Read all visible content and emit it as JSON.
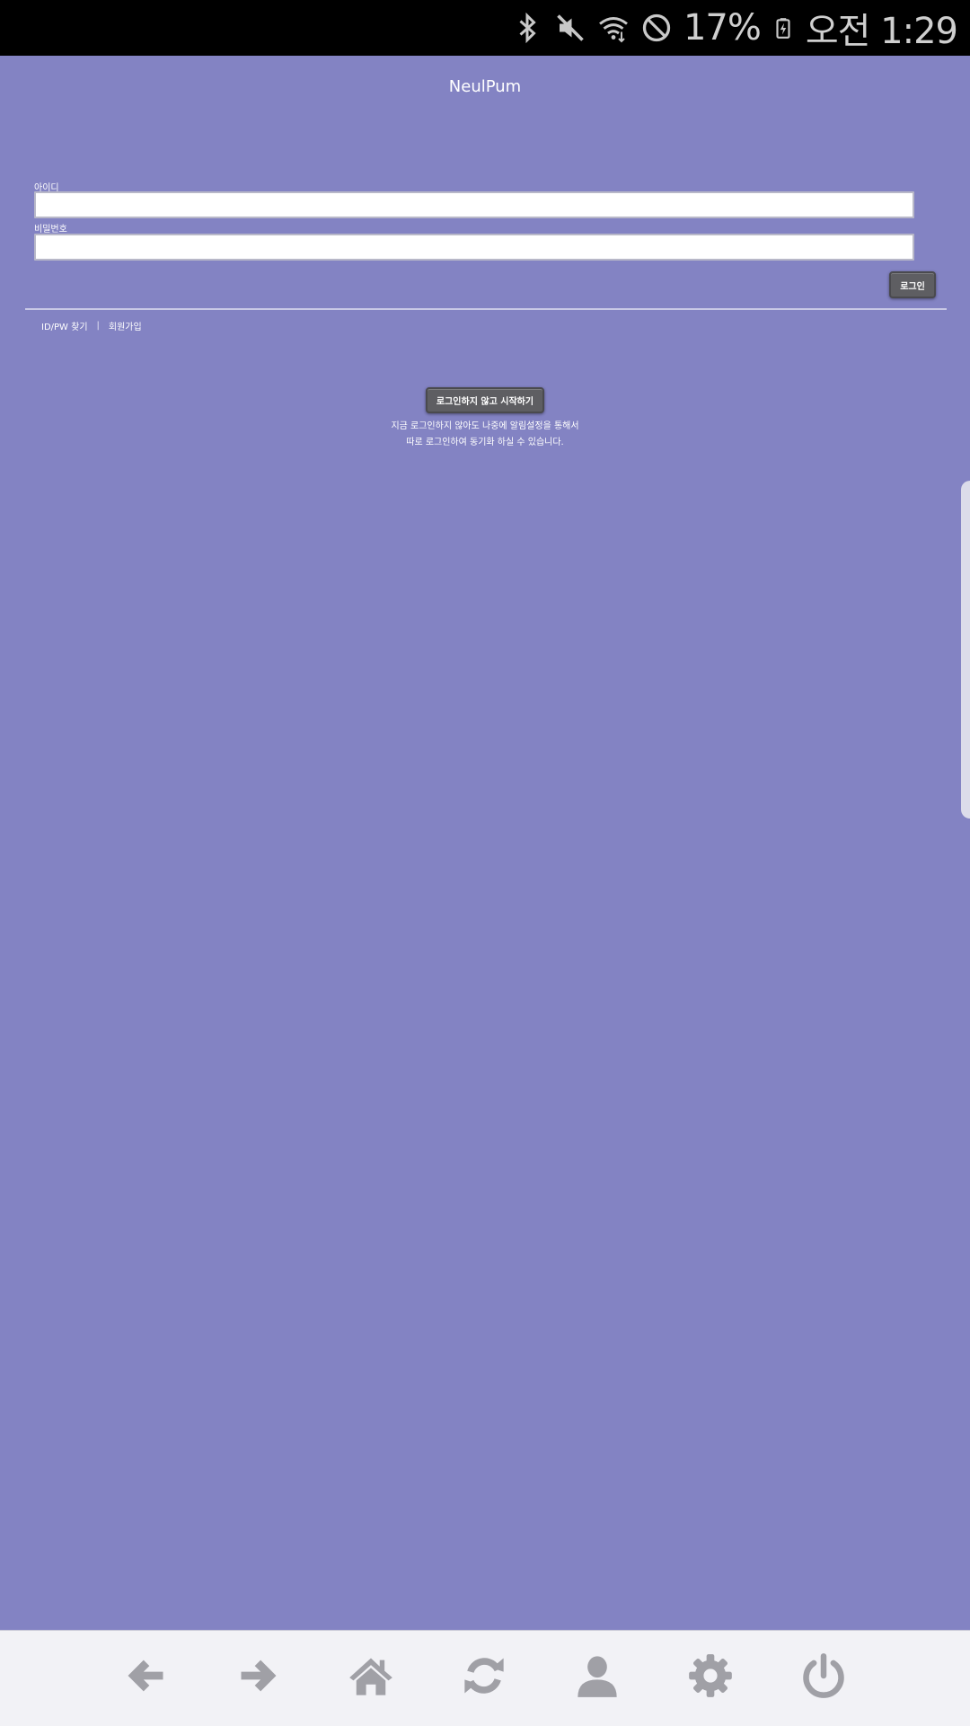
{
  "status_bar": {
    "battery_percent": "17%",
    "time": "오전 1:29",
    "icons": [
      "bluetooth-icon",
      "mute-icon",
      "wifi-icon",
      "do-not-disturb-icon",
      "battery-icon"
    ]
  },
  "header": {
    "title": "NeulPum"
  },
  "login_form": {
    "id_label": "아이디",
    "id_value": "",
    "password_label": "비밀번호",
    "password_value": "",
    "login_button": "로그인"
  },
  "links": {
    "find_id_pw": "ID/PW 찾기",
    "separator": "|",
    "signup": "회원가입"
  },
  "guest": {
    "button": "로그인하지 않고 시작하기",
    "desc_line1": "지금 로그인하지 않아도 나중에 알림설정을 통해서",
    "desc_line2": "따로 로그인하여 동기화 하실 수 있습니다."
  },
  "toolbar": {
    "buttons": [
      "back-arrow-icon",
      "forward-arrow-icon",
      "home-icon",
      "refresh-icon",
      "user-icon",
      "gear-icon",
      "power-icon"
    ],
    "icon_color": "#a0a0a6"
  },
  "colors": {
    "background": "#8383c3",
    "button": "#5e5e62",
    "toolbar_bg": "#f2f2f6"
  }
}
